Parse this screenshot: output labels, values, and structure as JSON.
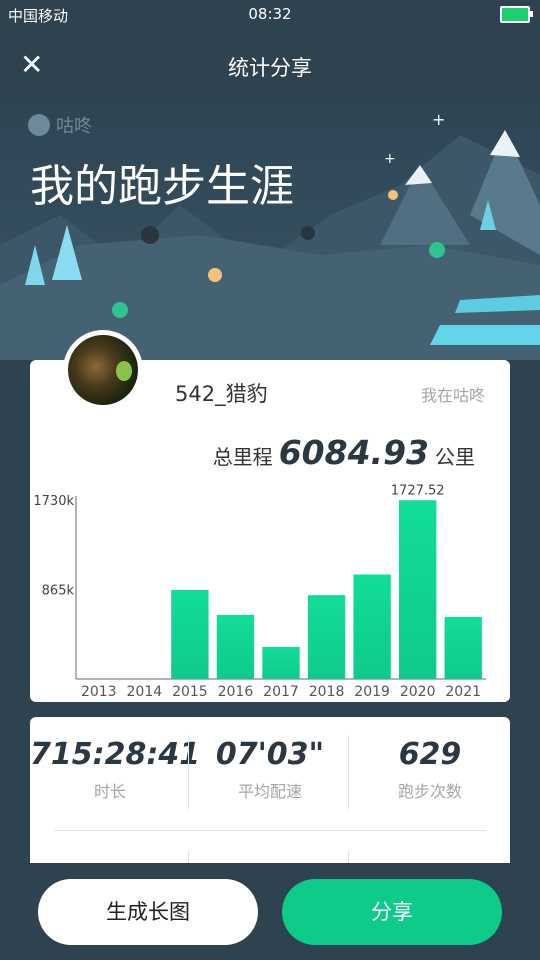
{
  "status_bar": {
    "carrier": "中国移动",
    "time": "08:32"
  },
  "nav": {
    "close_icon": "close-icon",
    "title": "统计分享"
  },
  "hero": {
    "brand": "咕咚",
    "headline": "我的跑步生涯"
  },
  "profile": {
    "username": "542_猎豹",
    "place": "我在咕咚"
  },
  "total": {
    "label": "总里程",
    "value": "6084.93",
    "unit": "公里"
  },
  "chart_data": {
    "type": "bar",
    "categories": [
      "2013",
      "2014",
      "2015",
      "2016",
      "2017",
      "2018",
      "2019",
      "2020",
      "2021"
    ],
    "values": [
      0,
      0,
      860,
      620,
      310,
      810,
      1010,
      1727.52,
      600
    ],
    "ylim": [
      0,
      1730
    ],
    "yticks": [
      {
        "value": 865,
        "label": "865k"
      },
      {
        "value": 1730,
        "label": "1730k"
      }
    ],
    "data_labels": [
      {
        "index": 7,
        "label": "1727.52"
      }
    ],
    "bar_color": "#0fcb8a"
  },
  "stats": [
    {
      "value": "715:28:41",
      "label": "时长"
    },
    {
      "value": "07'03\"",
      "label": "平均配速"
    },
    {
      "value": "629",
      "label": "跑步次数"
    }
  ],
  "buttons": {
    "generate": "生成长图",
    "share": "分享"
  }
}
